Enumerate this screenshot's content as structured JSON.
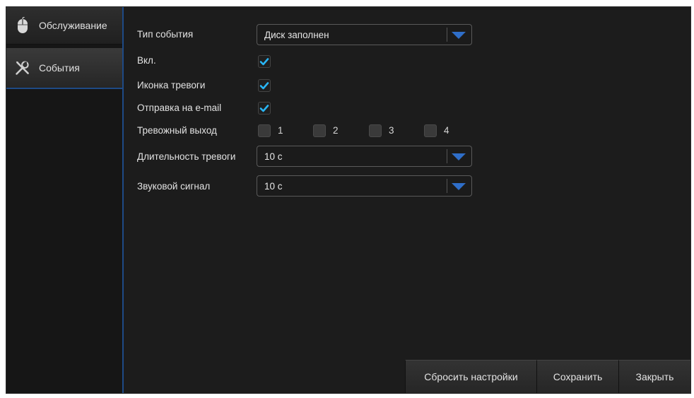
{
  "sidebar": {
    "items": [
      {
        "label": "Обслуживание",
        "icon": "mouse-icon"
      },
      {
        "label": "События",
        "icon": "tools-icon"
      }
    ]
  },
  "form": {
    "event_type": {
      "label": "Тип события",
      "value": "Диск заполнен"
    },
    "enabled": {
      "label": "Вкл.",
      "checked": true
    },
    "alarm_icon": {
      "label": "Иконка тревоги",
      "checked": true
    },
    "email": {
      "label": "Отправка на e-mail",
      "checked": true
    },
    "alarm_output": {
      "label": "Тревожный выход",
      "options": [
        {
          "label": "1",
          "checked": false
        },
        {
          "label": "2",
          "checked": false
        },
        {
          "label": "3",
          "checked": false
        },
        {
          "label": "4",
          "checked": false
        }
      ]
    },
    "alarm_duration": {
      "label": "Длительность тревоги",
      "value": "10 с"
    },
    "buzzer": {
      "label": "Звуковой сигнал",
      "value": "10 с"
    }
  },
  "buttons": {
    "reset": "Сбросить настройки",
    "save": "Сохранить",
    "close": "Закрыть"
  },
  "colors": {
    "accent": "#2f6ec8",
    "check": "#29b6f6",
    "background": "#1c1c1c"
  }
}
